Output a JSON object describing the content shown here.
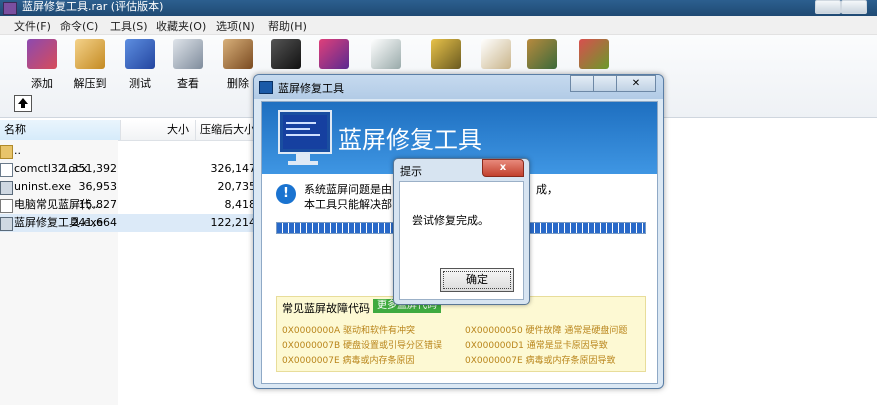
{
  "main_window": {
    "title": "蓝屏修复工具.rar (评估版本)"
  },
  "menu": [
    "文件(F)",
    "命令(C)",
    "工具(S)",
    "收藏夹(O)",
    "选项(N)",
    "帮助(H)"
  ],
  "toolbar": {
    "buttons": [
      {
        "label": "添加",
        "icon": "archive-add-icon",
        "color": "#8c4ab0"
      },
      {
        "label": "解压到",
        "icon": "extract-folder-icon",
        "color": "#d9a93e"
      },
      {
        "label": "测试",
        "icon": "test-archive-icon",
        "color": "#2e5fb8"
      },
      {
        "label": "查看",
        "icon": "view-glasses-icon",
        "color": "#7f8c9c"
      },
      {
        "label": "删除",
        "icon": "delete-archive-icon",
        "color": "#8b5e34"
      }
    ],
    "more_icons": [
      "find-binoculars-icon",
      "wizard-icon",
      "info-icon",
      "virus-scan-icon",
      "comment-icon",
      "protect-shield-icon",
      "sfx-icon"
    ]
  },
  "file_list": {
    "columns": [
      "名称",
      "大小",
      "压缩后大小"
    ],
    "rows": [
      {
        "name": "..",
        "size": "",
        "packed": "",
        "icon": "folder-up-icon"
      },
      {
        "name": "comctl32.ocx",
        "size": "1,351,392",
        "packed": "326,147",
        "icon": "ocx-file-icon"
      },
      {
        "name": "uninst.exe",
        "size": "36,953",
        "packed": "20,735",
        "icon": "exe-file-icon"
      },
      {
        "name": "电脑常见蓝屏代...",
        "size": "15,827",
        "packed": "8,418",
        "icon": "text-file-icon"
      },
      {
        "name": "蓝屏修复工具.exe",
        "size": "241,664",
        "packed": "122,214",
        "icon": "exe-file-icon"
      }
    ]
  },
  "repair_dialog": {
    "title": "蓝屏修复工具",
    "banner_title": "蓝屏修复工具",
    "message_line1": "系统蓝屏问题是由",
    "message_line1_tail": "成，",
    "message_line2": "本工具只能解决部",
    "progress": 1.0,
    "codes_header": "常见蓝屏故障代码",
    "more_label": "更多蓝屏代码",
    "codes": [
      "0X0000000A 驱动和软件有冲突",
      "0X00000050 硬件故障 通常是硬盘问题",
      "0X0000007B 硬盘设置或引导分区错误",
      "0X000000D1 通常是显卡原因导致",
      "0X0000007E 病毒或内存条原因",
      "0X0000007E 病毒或内存条原因导致"
    ]
  },
  "prompt_dialog": {
    "title": "提示",
    "close": "x",
    "message": "尝试修复完成。",
    "ok_label": "确定"
  }
}
